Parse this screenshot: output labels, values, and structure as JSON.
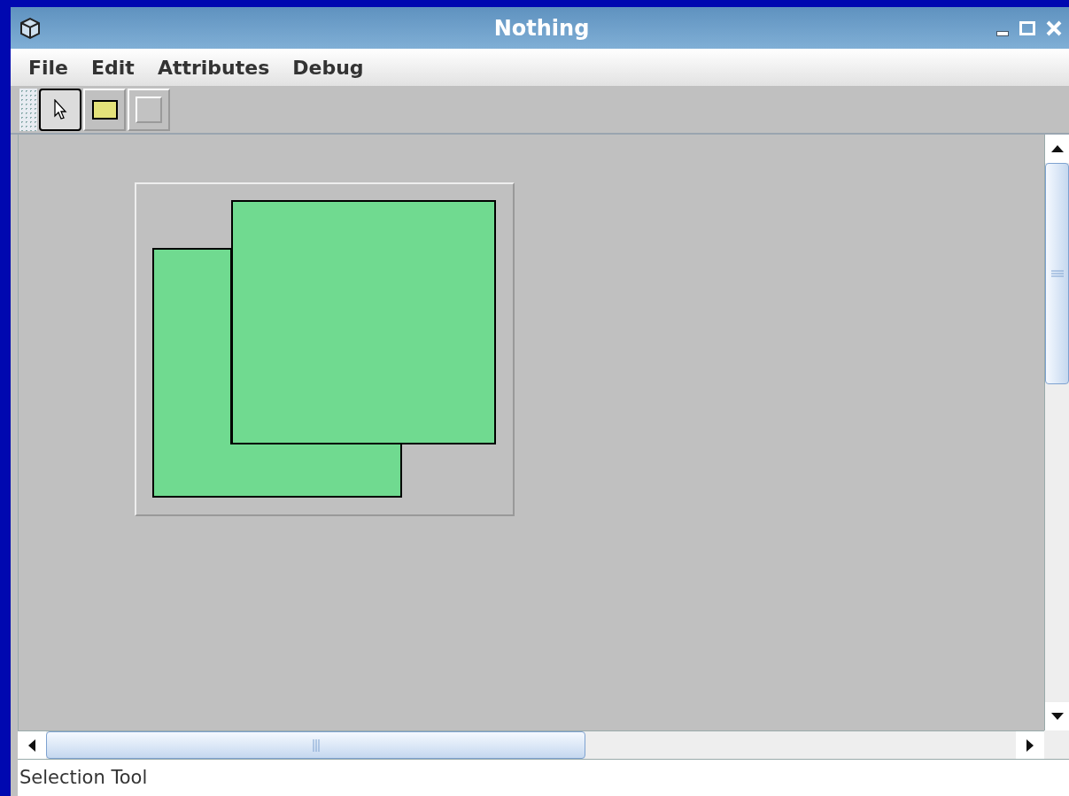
{
  "window": {
    "title": "Nothing"
  },
  "menu": [
    "File",
    "Edit",
    "Attributes",
    "Debug"
  ],
  "tools": [
    {
      "kind": "select",
      "selected": true
    },
    {
      "kind": "rectangle",
      "selected": false
    },
    {
      "kind": "blank",
      "selected": false
    }
  ],
  "status_bar": "Selection Tool"
}
